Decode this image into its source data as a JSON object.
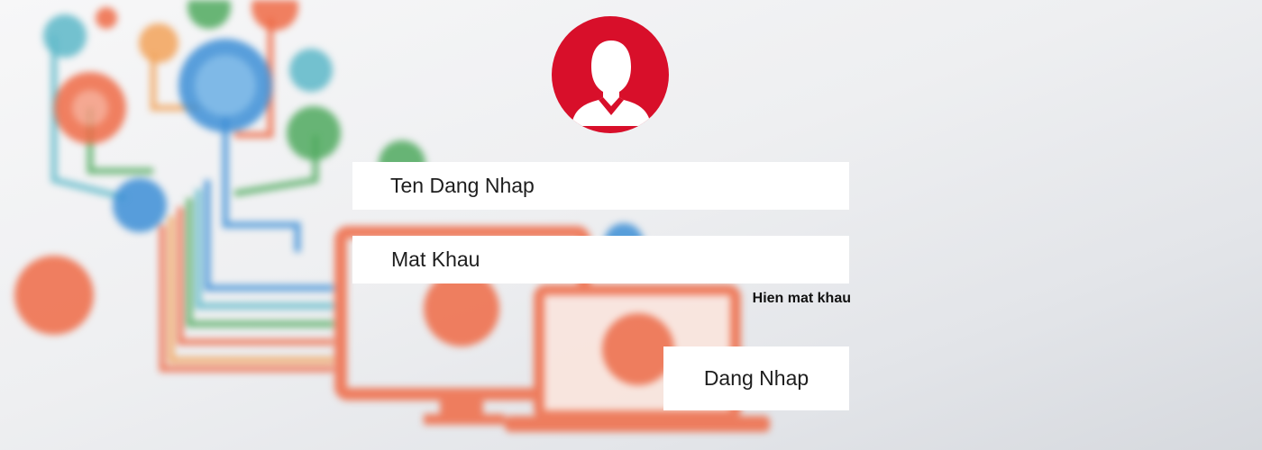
{
  "login": {
    "username_placeholder": "Ten Dang Nhap",
    "password_placeholder": "Mat Khau",
    "show_password_label": "Hien mat khau",
    "submit_label": "Dang Nhap"
  },
  "colors": {
    "avatar_bg": "#d80f2a",
    "art_orange": "#ef6a46",
    "art_blue": "#3d8fd6",
    "art_green": "#4faa5e"
  },
  "icons": {
    "avatar": "user-silhouette-icon"
  }
}
